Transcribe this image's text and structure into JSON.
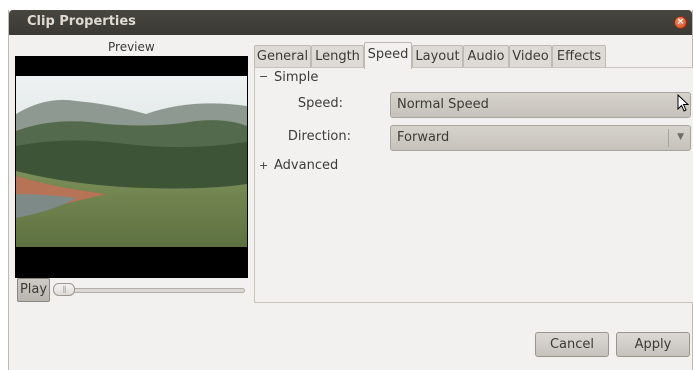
{
  "window": {
    "title": "Clip Properties",
    "close_glyph": "×"
  },
  "preview": {
    "label": "Preview",
    "play_label": "Play",
    "slider_thumb": "||"
  },
  "tabs": [
    {
      "label": "General",
      "active": false
    },
    {
      "label": "Length",
      "active": false
    },
    {
      "label": "Speed",
      "active": true
    },
    {
      "label": "Layout",
      "active": false
    },
    {
      "label": "Audio",
      "active": false
    },
    {
      "label": "Video",
      "active": false
    },
    {
      "label": "Effects",
      "active": false
    }
  ],
  "simple": {
    "expander_glyph": "−",
    "label": "Simple",
    "speed_label": "Speed:",
    "speed_value": "Normal Speed",
    "direction_label": "Direction:",
    "direction_value": "Forward"
  },
  "advanced": {
    "expander_glyph": "+",
    "label": "Advanced"
  },
  "buttons": {
    "cancel": "Cancel",
    "apply": "Apply"
  },
  "icons": {
    "close": "close-icon",
    "dropdown": "chevron-down-icon",
    "cursor": "mouse-pointer-icon"
  }
}
